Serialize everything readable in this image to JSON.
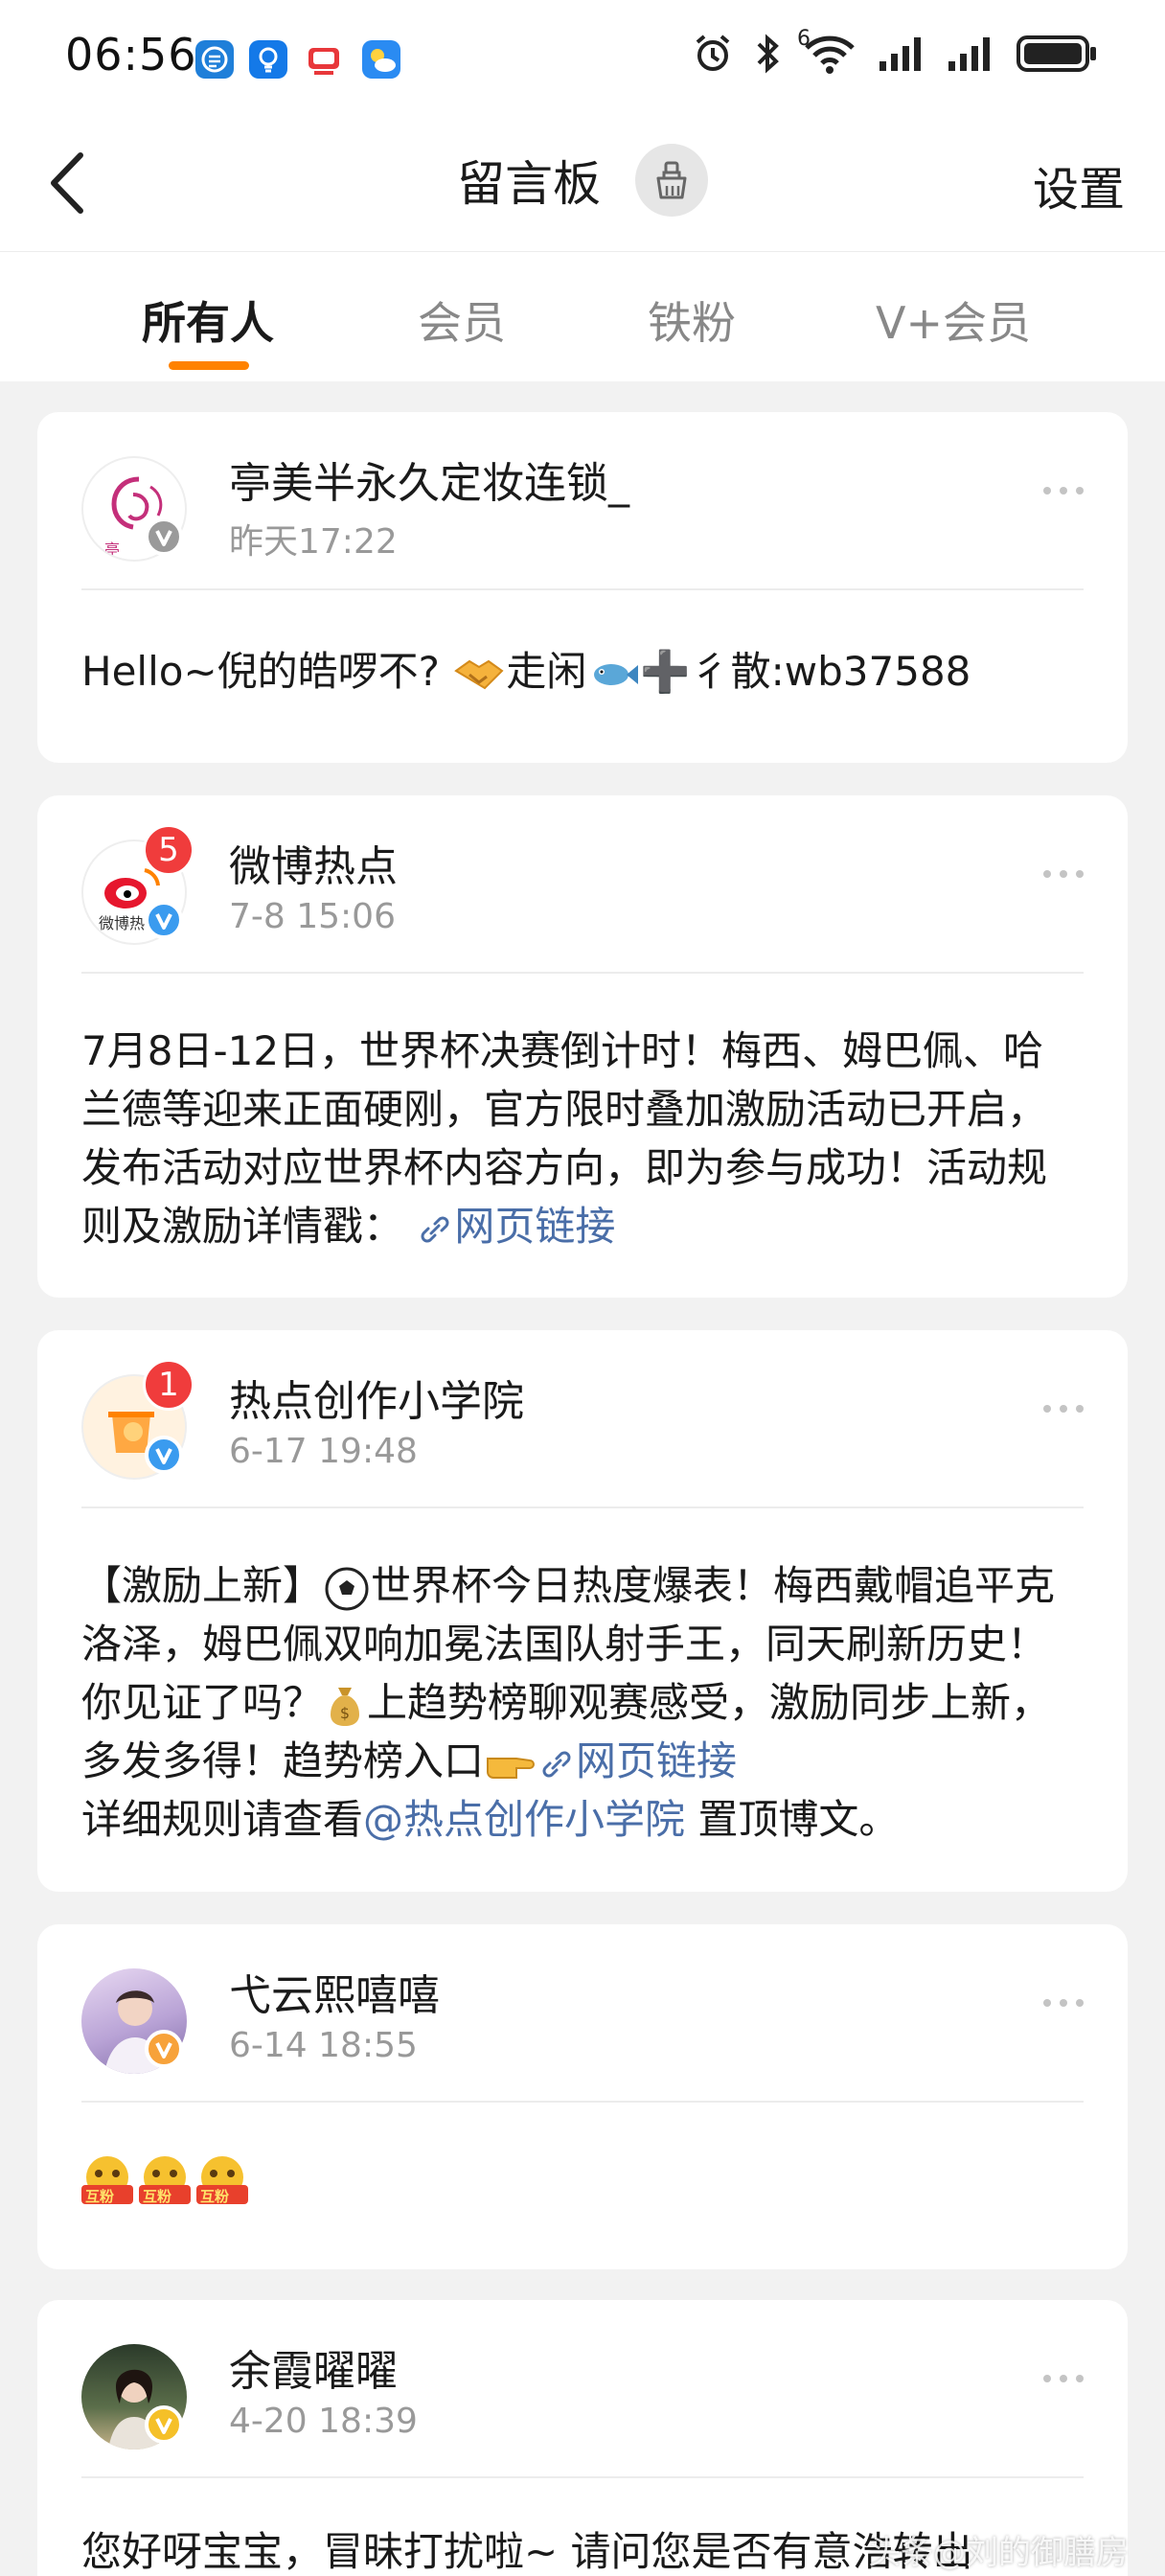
{
  "status_bar": {
    "time": "06:56",
    "network_label": "6"
  },
  "header": {
    "title": "留言板",
    "settings_label": "设置"
  },
  "tabs": [
    {
      "label": "所有人",
      "active": true
    },
    {
      "label": "会员",
      "active": false
    },
    {
      "label": "铁粉",
      "active": false
    },
    {
      "label": "V+会员",
      "active": false
    }
  ],
  "messages": [
    {
      "user": "亭美半永久定妆连锁_",
      "time": "昨天17:22",
      "avatar_text": "亭",
      "verify": "gray",
      "text_a": "Hello~倪的皓啰不?",
      "text_b": "走闲",
      "text_c": "➕彳散:wb37588"
    },
    {
      "user": "微博热点",
      "time": "7-8 15:06",
      "avatar_text": "微博热",
      "badge": "5",
      "verify": "blue",
      "text": "7月8日-12日，世界杯决赛倒计时！梅西、姆巴佩、哈兰德等迎来正面硬刚，官方限时叠加激励活动已开启，发布活动对应世界杯内容方向，即为参与成功！活动规则及激励详情戳：",
      "link": "网页链接"
    },
    {
      "user": "热点创作小学院",
      "time": "6-17 19:48",
      "badge": "1",
      "verify": "blue",
      "text_a": "【激励上新】",
      "text_b": "世界杯今日热度爆表！梅西戴帽追平克洛泽，姆巴佩双响加冕法国队射手王，同天刷新历史！你见证了吗？",
      "text_c": "上趋势榜聊观赛感受，激励同步上新，多发多得！趋势榜入口",
      "link": "网页链接",
      "text_d": "详细规则请查看",
      "mention": "@热点创作小学院",
      "text_e": " 置顶博文。"
    },
    {
      "user": "弋云熙嘻嘻",
      "time": "6-14 18:55",
      "verify": "orange",
      "emoji_label": "互粉"
    },
    {
      "user": "余霞曜曜",
      "time": "4-20 18:39",
      "verify": "yellow",
      "text": "您好呀宝宝，冒昧打扰啦~ 请问您是否有意浩转出"
    }
  ],
  "watermark": "头条@刘的御膳房",
  "colors": {
    "accent": "#ff8200",
    "link": "#4a6ea8",
    "badge": "#f03c3c",
    "verify_blue": "#3a9bef",
    "verify_orange": "#f7a23a",
    "verify_gray": "#9a9a9a"
  }
}
